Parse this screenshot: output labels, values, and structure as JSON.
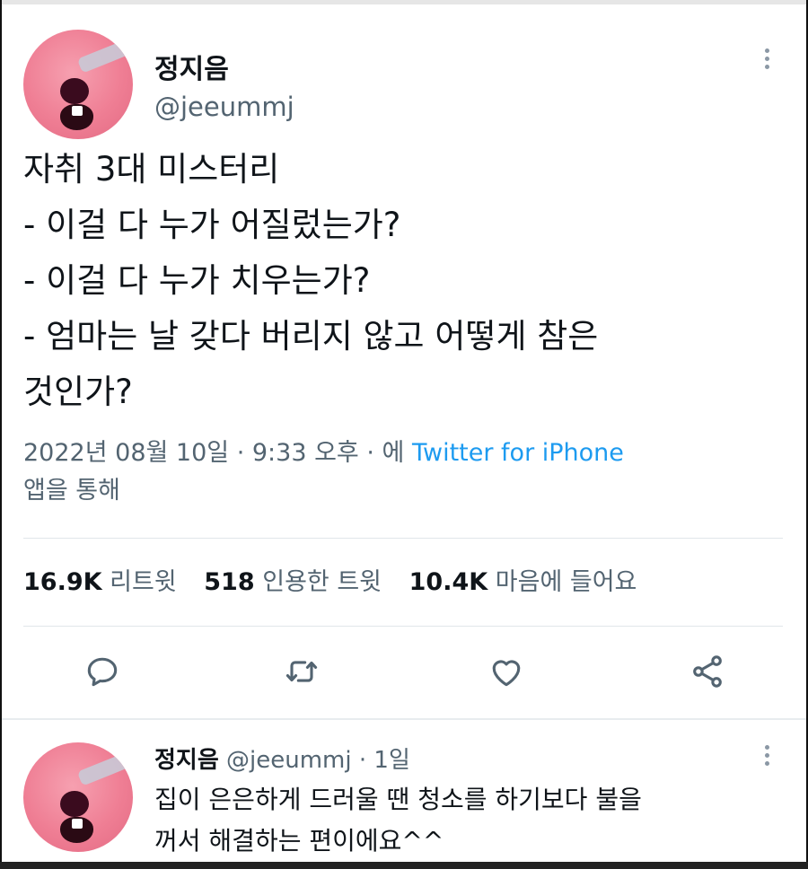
{
  "tweet": {
    "author": {
      "name": "정지음",
      "handle": "@jeeummj"
    },
    "lines": [
      "자취 3대 미스터리",
      "- 이걸 다 누가 어질렀는가?",
      "- 이걸 다 누가 치우는가?",
      "- 엄마는 날 갖다 버리지 않고 어떻게 참은",
      "것인가?"
    ],
    "meta": {
      "date": "2022년 08월 10일",
      "sep": " · ",
      "time": "9:33 오후",
      "via_prefix": "에 ",
      "source": "Twitter for iPhone",
      "via_suffix": "앱을 통해"
    },
    "stats": {
      "retweets_count": "16.9K",
      "retweets_label": "리트윗",
      "quotes_count": "518",
      "quotes_label": "인용한 트윗",
      "likes_count": "10.4K",
      "likes_label": "마음에 들어요"
    },
    "actions": [
      "reply",
      "retweet",
      "like",
      "share"
    ]
  },
  "reply": {
    "name": "정지음",
    "handle": "@jeeummj",
    "sep": " · ",
    "time": "1일",
    "lines": [
      "집이 은은하게 드러울 땐 청소를 하기보다 불을",
      "꺼서 해결하는 편이에요^^"
    ]
  },
  "colors": {
    "link": "#1d9bf0",
    "muted": "#536471",
    "text": "#0f1419"
  }
}
